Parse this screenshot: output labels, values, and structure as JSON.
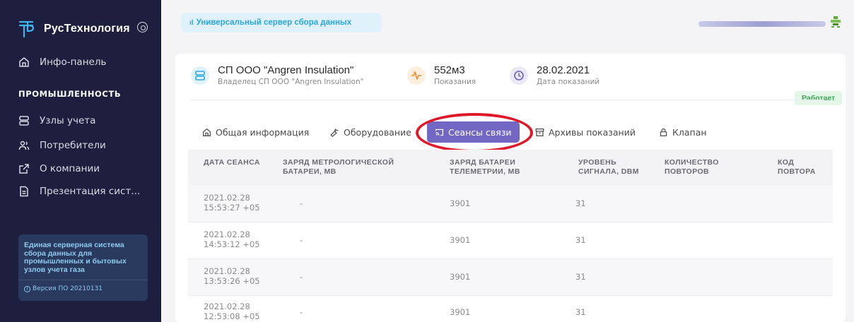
{
  "sidebar": {
    "brand": "РусТехнология",
    "items": [
      {
        "label": "Инфо-панель",
        "icon": "home-icon"
      },
      {
        "label": "Узлы учета",
        "icon": "server-icon"
      },
      {
        "label": "Потребители",
        "icon": "users-icon"
      },
      {
        "label": "О компании",
        "icon": "external-link-icon"
      },
      {
        "label": "Презентация сист...",
        "icon": "document-icon"
      }
    ],
    "section_title": "ПРОМЫШЛЕННОСТЬ",
    "info_text": "Единая серверная система сбора данных для промышленных и бытовых узлов учета газа",
    "version": "Версия ПО 20210131"
  },
  "topbar": {
    "title": "Универсальный сервер сбора данных"
  },
  "summary": {
    "name": "СП ООО \"Angren Insulation\"",
    "owner": "Владелец СП ООО \"Angren Insulation\"",
    "reading_value": "552м3",
    "reading_label": "Показания",
    "date_value": "28.02.2021",
    "date_label": "Дата показаний",
    "status": "Работает"
  },
  "tabs": [
    {
      "label": "Общая информация",
      "icon": "home-icon"
    },
    {
      "label": "Оборудование",
      "icon": "wrench-icon"
    },
    {
      "label": "Сеансы связи",
      "icon": "cast-icon",
      "active": true
    },
    {
      "label": "Архивы показаний",
      "icon": "archive-icon"
    },
    {
      "label": "Клапан",
      "icon": "lock-icon"
    }
  ],
  "table": {
    "columns": [
      "ДАТА СЕАНСА",
      "ЗАРЯД МЕТРОЛОГИЧЕСКОЙ БАТАРЕИ, МВ",
      "ЗАРЯД БАТАРЕИ ТЕЛЕМЕТРИИ, МВ",
      "УРОВЕНЬ СИГНАЛА, DBM",
      "КОЛИЧЕСТВО ПОВТОРОВ",
      "КОД ПОВТОРА"
    ],
    "rows": [
      {
        "date": "2021.02.28",
        "time": "15:53:27 +05",
        "metro": "-",
        "telemetry": "3901",
        "signal": "31",
        "repeats": "",
        "code": ""
      },
      {
        "date": "2021.02.28",
        "time": "14:53:12 +05",
        "metro": "-",
        "telemetry": "3901",
        "signal": "31",
        "repeats": "",
        "code": ""
      },
      {
        "date": "2021.02.28",
        "time": "13:53:26 +05",
        "metro": "-",
        "telemetry": "3901",
        "signal": "31",
        "repeats": "",
        "code": ""
      },
      {
        "date": "2021.02.28",
        "time": "12:53:08 +05",
        "metro": "-",
        "telemetry": "3901",
        "signal": "31",
        "repeats": "",
        "code": ""
      }
    ]
  },
  "colors": {
    "sidebar_bg": "#1e1f3f",
    "accent": "#7367c4",
    "status_green": "#3da55a",
    "highlight_red": "#e0192a",
    "info_blue": "#2aa6e0"
  }
}
